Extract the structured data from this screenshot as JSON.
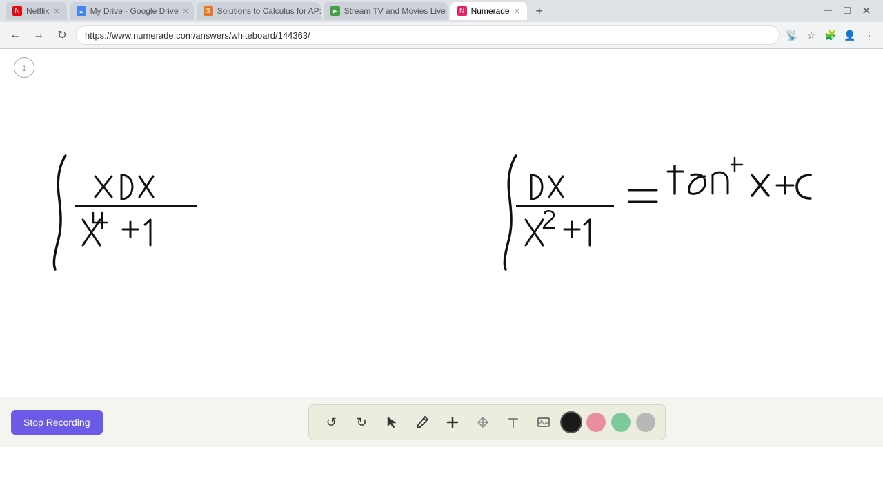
{
  "browser": {
    "tabs": [
      {
        "id": "netflix",
        "label": "Netflix",
        "favicon_color": "#e50914",
        "favicon_char": "N",
        "active": false
      },
      {
        "id": "googledrive",
        "label": "My Drive - Google Drive",
        "favicon_color": "#4285f4",
        "favicon_char": "▲",
        "active": false
      },
      {
        "id": "calculus",
        "label": "Solutions to Calculus for AP: Ea...",
        "favicon_color": "#e87722",
        "favicon_char": "S",
        "active": false
      },
      {
        "id": "stream",
        "label": "Stream TV and Movies Live and ...",
        "favicon_color": "#43a047",
        "favicon_char": "▶",
        "active": false
      },
      {
        "id": "numerade",
        "label": "Numerade",
        "favicon_color": "#e91e63",
        "favicon_char": "N",
        "active": true
      }
    ],
    "url": "https://www.numerade.com/answers/whiteboard/144363/",
    "nav": {
      "back": "←",
      "forward": "→",
      "refresh": "↻"
    }
  },
  "whiteboard": {
    "page_number": "1"
  },
  "toolbar": {
    "stop_recording_label": "Stop Recording",
    "tools": [
      {
        "id": "undo",
        "label": "↺",
        "name": "undo-tool"
      },
      {
        "id": "redo",
        "label": "↻",
        "name": "redo-tool"
      },
      {
        "id": "select",
        "label": "↖",
        "name": "select-tool"
      },
      {
        "id": "pen",
        "label": "✏",
        "name": "pen-tool"
      },
      {
        "id": "add",
        "label": "+",
        "name": "add-tool"
      },
      {
        "id": "highlight",
        "label": "✂",
        "name": "highlight-tool"
      },
      {
        "id": "text",
        "label": "A",
        "name": "text-tool"
      },
      {
        "id": "image",
        "label": "🖼",
        "name": "image-tool"
      }
    ],
    "colors": [
      {
        "id": "black",
        "hex": "#1a1a1a",
        "active": true
      },
      {
        "id": "pink",
        "hex": "#e88ea0",
        "active": false
      },
      {
        "id": "green",
        "hex": "#7dc99a",
        "active": false
      },
      {
        "id": "gray",
        "hex": "#b0b0b0",
        "active": false
      }
    ]
  }
}
